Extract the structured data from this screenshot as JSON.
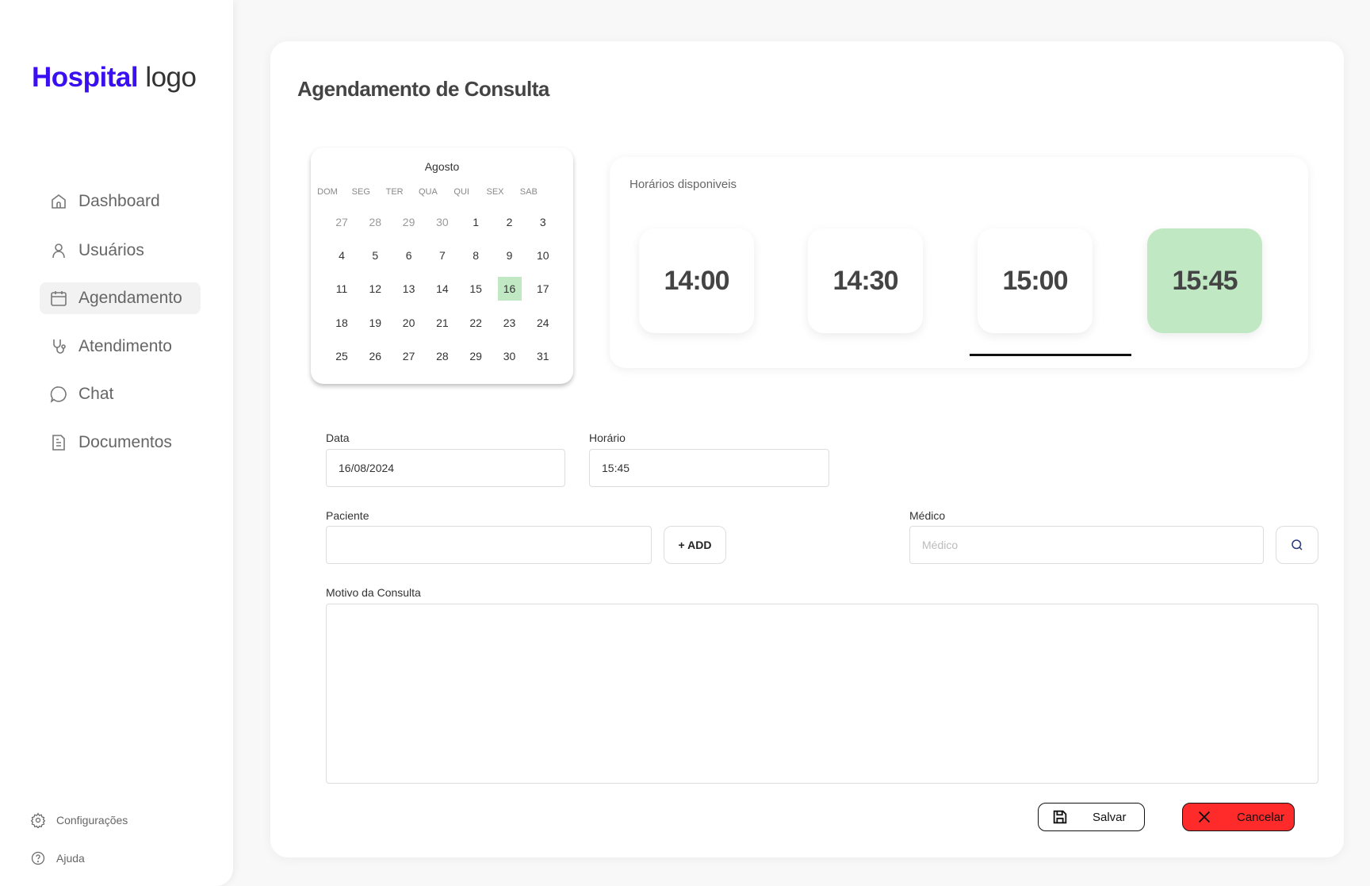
{
  "sidebar": {
    "logo_bold": "Hospital",
    "logo_light": "logo",
    "items": [
      {
        "label": "Dashboard",
        "icon": "home-icon"
      },
      {
        "label": "Usuários",
        "icon": "user-icon"
      },
      {
        "label": "Agendamento",
        "icon": "calendar-icon",
        "active": true
      },
      {
        "label": "Atendimento",
        "icon": "stethoscope-icon"
      },
      {
        "label": "Chat",
        "icon": "chat-icon"
      },
      {
        "label": "Documentos",
        "icon": "document-icon"
      }
    ],
    "settings_label": "Configurações",
    "help_label": "Ajuda"
  },
  "page": {
    "title": "Agendamento de Consulta"
  },
  "calendar": {
    "month": "Agosto",
    "weekdays": [
      "DOM",
      "SEG",
      "TER",
      "QUA",
      "QUI",
      "SEX",
      "SAB"
    ],
    "weeks": [
      [
        "27",
        "28",
        "29",
        "30",
        "1",
        "2",
        "3"
      ],
      [
        "4",
        "5",
        "6",
        "7",
        "8",
        "9",
        "10"
      ],
      [
        "11",
        "12",
        "13",
        "14",
        "15",
        "16",
        "17"
      ],
      [
        "18",
        "19",
        "20",
        "21",
        "22",
        "23",
        "24"
      ],
      [
        "25",
        "26",
        "27",
        "28",
        "29",
        "30",
        "31"
      ]
    ],
    "selected_day": "16",
    "selected_color": "#bfe8c3"
  },
  "slots": {
    "label": "Horários disponiveis",
    "times": [
      "14:00",
      "14:30",
      "15:00",
      "15:45"
    ],
    "selected": "15:45"
  },
  "form": {
    "date_label": "Data",
    "date_value": "16/08/2024",
    "time_label": "Horário",
    "time_value": "15:45",
    "patient_label": "Paciente",
    "patient_value": "",
    "add_label": "+ ADD",
    "doctor_label": "Médico",
    "doctor_placeholder": "Médico",
    "reason_label": "Motivo da Consulta",
    "reason_value": ""
  },
  "actions": {
    "save_label": "Salvar",
    "cancel_label": "Cancelar",
    "cancel_color": "#ff2b2b"
  }
}
